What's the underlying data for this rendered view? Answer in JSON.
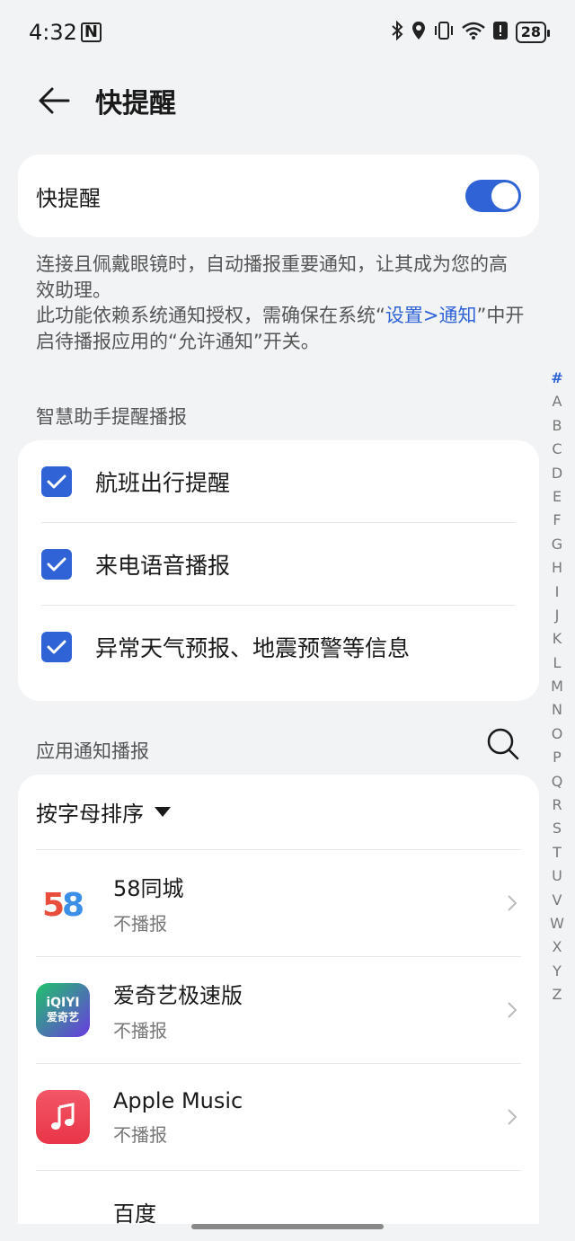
{
  "status": {
    "time": "4:32",
    "battery": "28"
  },
  "header": {
    "title": "快提醒"
  },
  "toggle": {
    "label": "快提醒",
    "on": true
  },
  "description": {
    "part1": "连接且佩戴眼镜时，自动播报重要通知，让其成为您的高效助理。",
    "part2": "此功能依赖系统通知授权，需确保在系统“",
    "link": "设置>通知",
    "part3": "”中开启待播报应用的“允许通知”开关。"
  },
  "assistant_section": {
    "title": "智慧助手提醒播报",
    "items": [
      {
        "label": "航班出行提醒",
        "checked": true
      },
      {
        "label": "来电语音播报",
        "checked": true
      },
      {
        "label": "异常天气预报、地震预警等信息",
        "checked": true
      }
    ]
  },
  "apps_section": {
    "title": "应用通知播报",
    "sort_label": "按字母排序",
    "apps": [
      {
        "name": "58同城",
        "status": "不播报",
        "icon": "app-58-icon"
      },
      {
        "name": "爱奇艺极速版",
        "status": "不播报",
        "icon": "app-iqiyi-icon",
        "icon_text": "iQIYI",
        "icon_text2": "爱奇艺"
      },
      {
        "name": "Apple Music",
        "status": "不播报",
        "icon": "app-music-icon"
      },
      {
        "name": "百度",
        "status": "",
        "icon": "app-baidu-icon"
      }
    ]
  },
  "index_letters": [
    "#",
    "A",
    "B",
    "C",
    "D",
    "E",
    "F",
    "G",
    "H",
    "I",
    "J",
    "K",
    "L",
    "M",
    "N",
    "O",
    "P",
    "Q",
    "R",
    "S",
    "T",
    "U",
    "V",
    "W",
    "X",
    "Y",
    "Z"
  ],
  "colors": {
    "accent": "#2f63d6",
    "background": "#f1f3f5"
  }
}
